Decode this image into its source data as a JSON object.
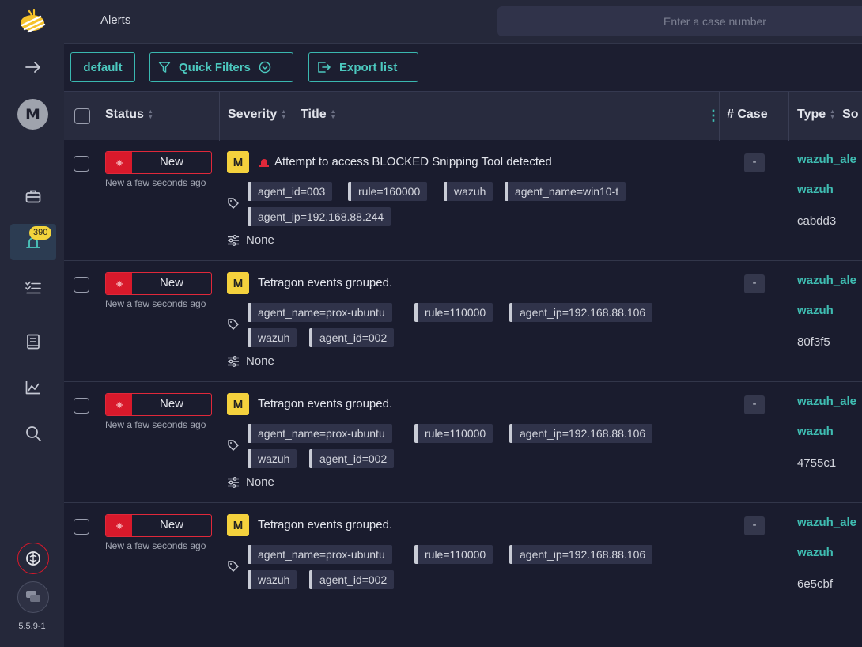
{
  "header": {
    "title": "Alerts",
    "case_search_placeholder": "Enter a case number"
  },
  "sidebar": {
    "avatar_letter": "M",
    "alerts_badge": "390",
    "version": "5.5.9-1"
  },
  "toolbar": {
    "default_label": "default",
    "quick_filters_label": "Quick Filters",
    "export_label": "Export list"
  },
  "table": {
    "columns": {
      "status": "Status",
      "severity": "Severity",
      "title": "Title",
      "case": "# Case",
      "type": "Type",
      "source": "So"
    },
    "rows": [
      {
        "status": "New",
        "time": "New a few seconds ago",
        "severity": "M",
        "title": "Attempt to access BLOCKED Snipping Tool detected",
        "tags": [
          "agent_id=003",
          "rule=160000",
          "wazuh",
          "agent_name=win10-t",
          "agent_ip=192.168.88.244"
        ],
        "none_label": "None",
        "case": "-",
        "type_1": "wazuh_ale",
        "type_2": "wazuh",
        "type_3": "cabdd3"
      },
      {
        "status": "New",
        "time": "New a few seconds ago",
        "severity": "M",
        "title": "Tetragon events grouped.",
        "tags": [
          "agent_name=prox-ubuntu",
          "rule=110000",
          "agent_ip=192.168.88.106",
          "wazuh",
          "agent_id=002"
        ],
        "none_label": "None",
        "case": "-",
        "type_1": "wazuh_ale",
        "type_2": "wazuh",
        "type_3": "80f3f5"
      },
      {
        "status": "New",
        "time": "New a few seconds ago",
        "severity": "M",
        "title": "Tetragon events grouped.",
        "tags": [
          "agent_name=prox-ubuntu",
          "rule=110000",
          "agent_ip=192.168.88.106",
          "wazuh",
          "agent_id=002"
        ],
        "none_label": "None",
        "case": "-",
        "type_1": "wazuh_ale",
        "type_2": "wazuh",
        "type_3": "4755c1"
      },
      {
        "status": "New",
        "time": "New a few seconds ago",
        "severity": "M",
        "title": "Tetragon events grouped.",
        "tags": [
          "agent_name=prox-ubuntu",
          "rule=110000",
          "agent_ip=192.168.88.106",
          "wazuh",
          "agent_id=002"
        ],
        "case": "-",
        "type_1": "wazuh_ale",
        "type_2": "wazuh",
        "type_3": "6e5cbf"
      }
    ]
  },
  "colors": {
    "accent": "#4cc9bf",
    "status_new": "#d8192b",
    "severity_medium": "#f4d13d",
    "badge": "#f2d43c"
  }
}
